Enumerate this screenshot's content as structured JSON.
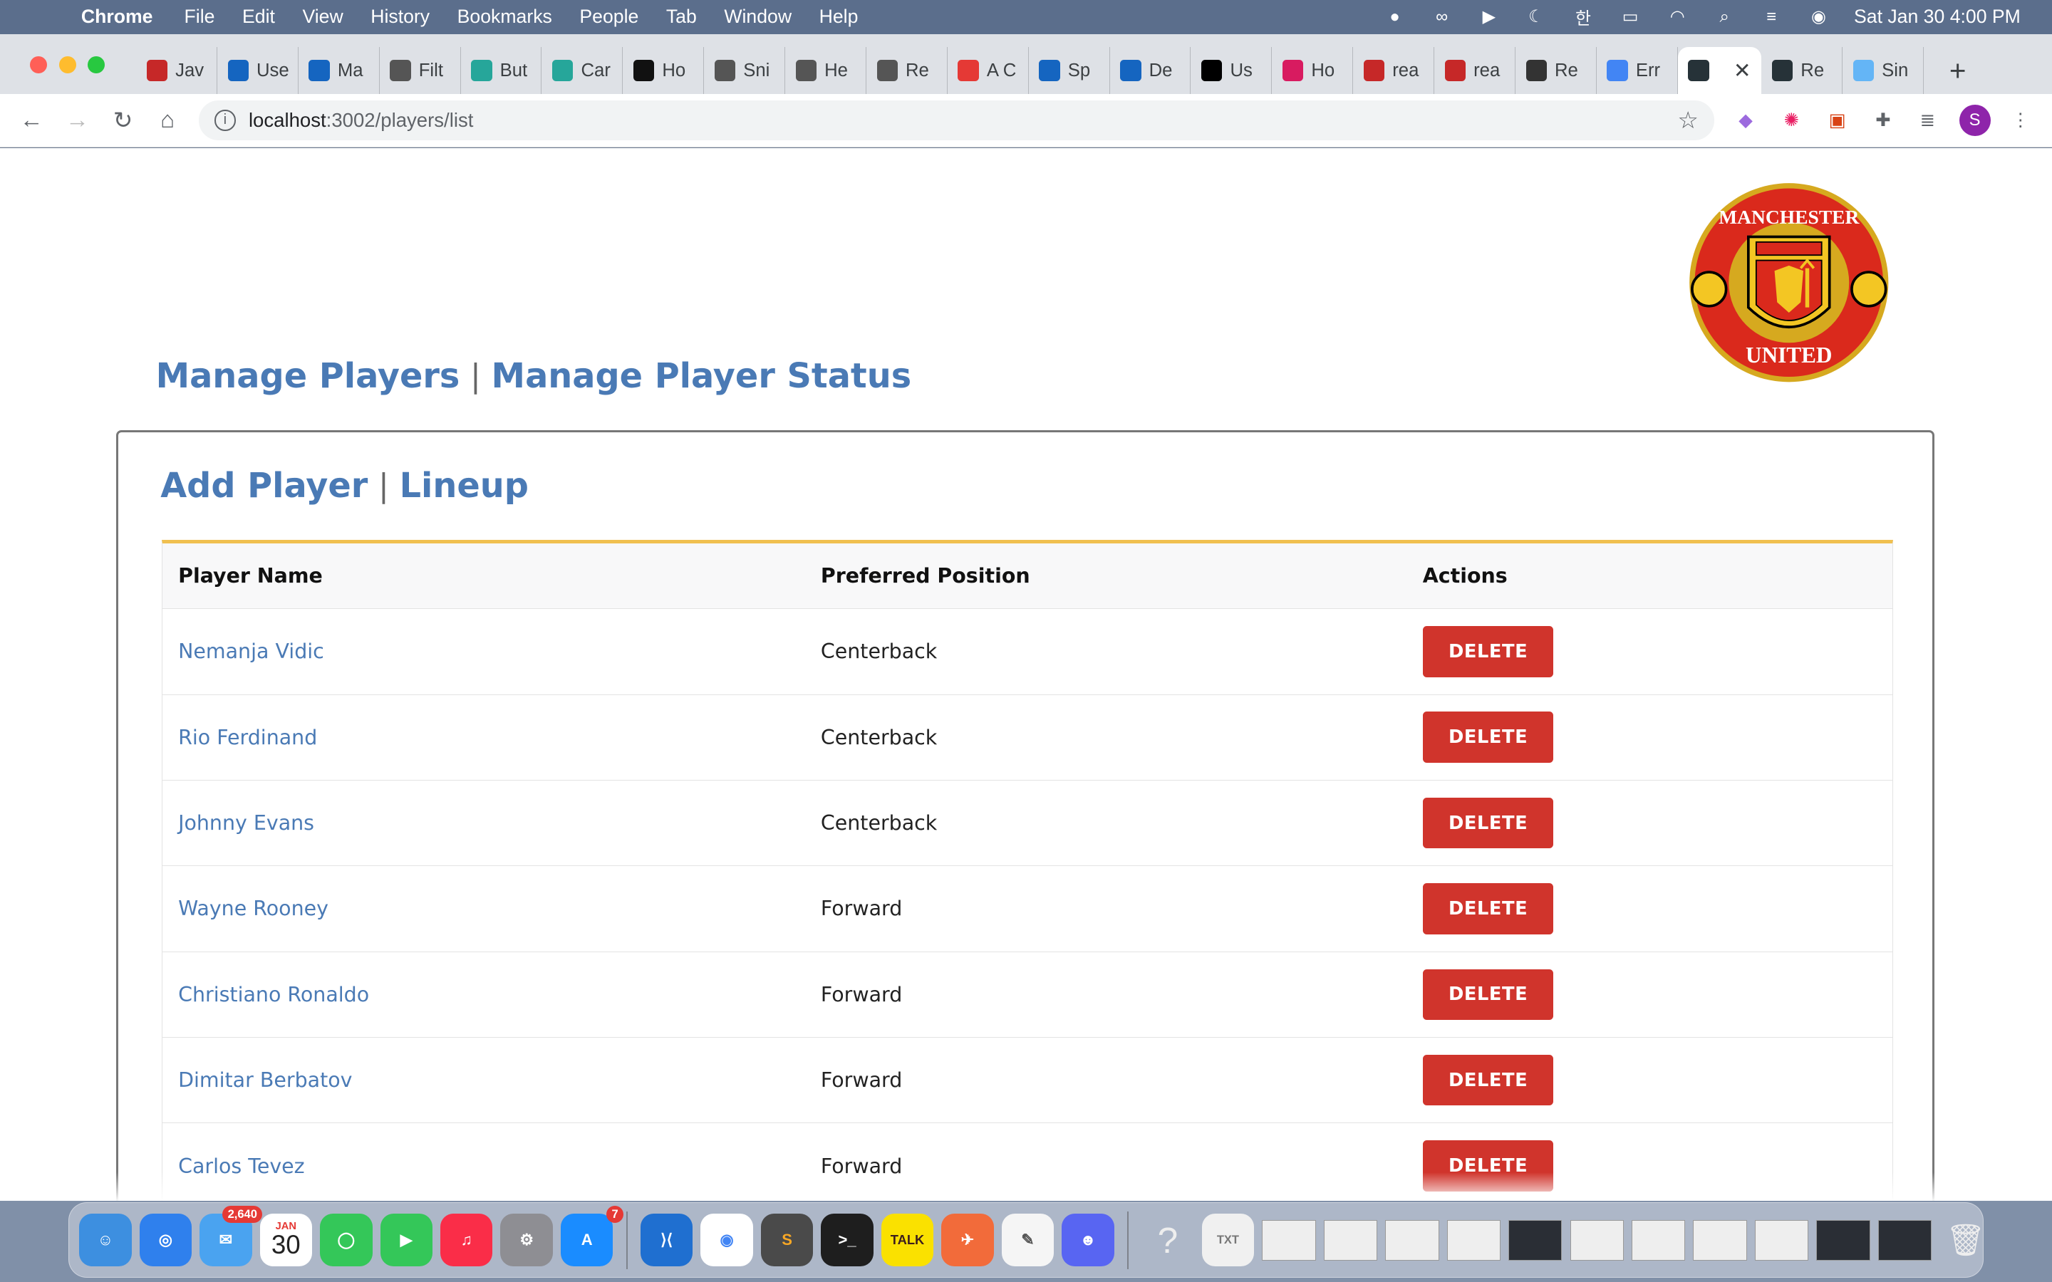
{
  "menubar": {
    "app": "Chrome",
    "items": [
      "File",
      "Edit",
      "View",
      "History",
      "Bookmarks",
      "People",
      "Tab",
      "Window",
      "Help"
    ],
    "clock": "Sat Jan 30  4:00 PM"
  },
  "browser": {
    "tabs": [
      {
        "label": "Jav",
        "icon": "javascript-tutorial-icon",
        "color": "#c62828"
      },
      {
        "label": "Use",
        "icon": "torii-icon",
        "color": "#1565c0"
      },
      {
        "label": "Ma",
        "icon": "torii-icon",
        "color": "#1565c0"
      },
      {
        "label": "Filt",
        "icon": "globe-icon",
        "color": "#555555"
      },
      {
        "label": "But",
        "icon": "react-icon",
        "color": "#26a69a"
      },
      {
        "label": "Car",
        "icon": "react-icon",
        "color": "#26a69a"
      },
      {
        "label": "Ho",
        "icon": "nextjs-icon",
        "color": "#111111"
      },
      {
        "label": "Sni",
        "icon": "globe-icon",
        "color": "#555555"
      },
      {
        "label": "He",
        "icon": "globe-icon",
        "color": "#555555"
      },
      {
        "label": "Re",
        "icon": "globe-icon",
        "color": "#555555"
      },
      {
        "label": "A C",
        "icon": "flower-icon",
        "color": "#e53935"
      },
      {
        "label": "Sp",
        "icon": "torii-icon",
        "color": "#1565c0"
      },
      {
        "label": "De",
        "icon": "torii-icon",
        "color": "#1565c0"
      },
      {
        "label": "Us",
        "icon": "medium-icon",
        "color": "#000000"
      },
      {
        "label": "Ho",
        "icon": "play-icon",
        "color": "#d81b60"
      },
      {
        "label": "rea",
        "icon": "npm-icon",
        "color": "#c62828"
      },
      {
        "label": "rea",
        "icon": "npm-icon",
        "color": "#c62828"
      },
      {
        "label": "Re",
        "icon": "codesandbox-icon",
        "color": "#333333"
      },
      {
        "label": "Err",
        "icon": "google-icon",
        "color": "#4285f4"
      }
    ],
    "active_tab": {
      "icon": "react-icon",
      "close": "✕"
    },
    "trailing_tabs": [
      {
        "label": "Re",
        "icon": "react-icon",
        "color": "#263238"
      },
      {
        "label": "Sin",
        "icon": "spinner-icon",
        "color": "#64b5f6"
      }
    ],
    "url_host": "localhost",
    "url_path": ":3002/players/list",
    "profile_initial": "S"
  },
  "page": {
    "logo_top_text": "MANCHESTER",
    "logo_bottom_text": "UNITED",
    "nav": {
      "manage_players": "Manage Players",
      "separator": "|",
      "manage_status": "Manage Player Status"
    },
    "subnav": {
      "add_player": "Add Player",
      "separator": "|",
      "lineup": "Lineup"
    },
    "table": {
      "headers": [
        "Player Name",
        "Preferred Position",
        "Actions"
      ],
      "rows": [
        {
          "name": "Nemanja Vidic",
          "position": "Centerback",
          "action": "DELETE"
        },
        {
          "name": "Rio Ferdinand",
          "position": "Centerback",
          "action": "DELETE"
        },
        {
          "name": "Johnny Evans",
          "position": "Centerback",
          "action": "DELETE"
        },
        {
          "name": "Wayne Rooney",
          "position": "Forward",
          "action": "DELETE"
        },
        {
          "name": "Christiano Ronaldo",
          "position": "Forward",
          "action": "DELETE"
        },
        {
          "name": "Dimitar Berbatov",
          "position": "Forward",
          "action": "DELETE"
        },
        {
          "name": "Carlos Tevez",
          "position": "Forward",
          "action": "DELETE"
        }
      ]
    }
  },
  "dock": {
    "mail_badge": "2,640",
    "calendar_month": "JAN",
    "calendar_day": "30",
    "appstore_badge": "7",
    "kakao_label": "TALK"
  },
  "colors": {
    "link": "#4a7ab5",
    "delete": "#d0342c",
    "table_accent": "#f0c050"
  }
}
